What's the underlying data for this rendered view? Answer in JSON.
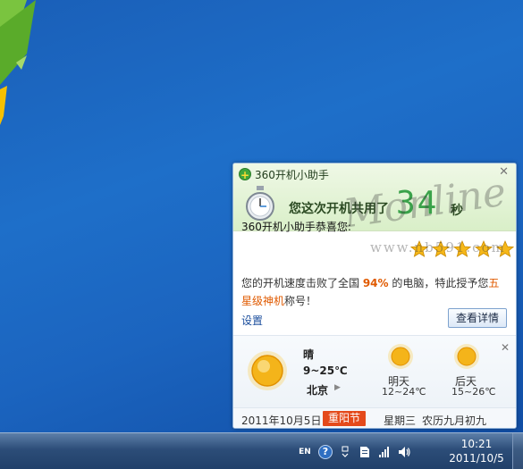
{
  "popup": {
    "title": "360开机小助手",
    "boot_text": "您这次开机共用了",
    "boot_seconds": "34",
    "boot_unit": "秒",
    "congrats": "360开机小助手恭喜您:",
    "rating_stars": 5,
    "desc_prefix": "您的开机速度击败了全国 ",
    "desc_percent": "94%",
    "desc_middle": " 的电脑，特此授予您",
    "desc_title": "五星级神机",
    "desc_suffix": "称号！",
    "settings_label": "设置",
    "detail_button": "查看详情",
    "close_icon": "close-icon"
  },
  "weather": {
    "today": {
      "condition": "晴",
      "temp": "9~25℃"
    },
    "city": "北京",
    "forecast": [
      {
        "day": "明天",
        "temp": "12~24℃"
      },
      {
        "day": "后天",
        "temp": "15~26℃"
      }
    ]
  },
  "date_bar": {
    "date": "2011年10月5日",
    "festival": "重阳节",
    "weekday": "星期三",
    "lunar": "农历九月初九"
  },
  "watermark": {
    "script": "Monline",
    "url": "www.nb591.com"
  },
  "taskbar": {
    "lang": "EN",
    "help": "?",
    "time": "10:21",
    "date": "2011/10/5"
  },
  "colors": {
    "accent_orange": "#e05a00",
    "festival_red": "#e44a1b",
    "link_blue": "#1a4d9c",
    "number_green": "#3aa24a"
  }
}
